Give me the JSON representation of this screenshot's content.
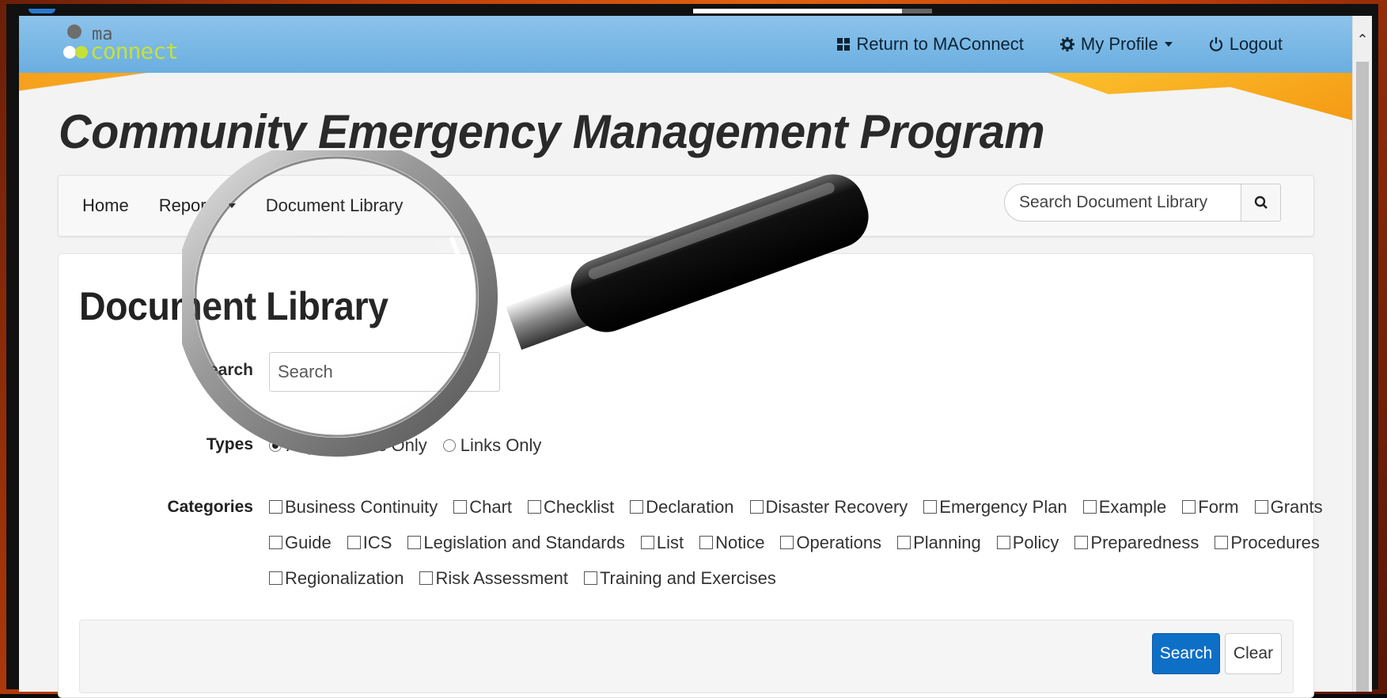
{
  "brand": {
    "logo_text_top": "ma",
    "logo_text_bottom": "connect",
    "colors": {
      "topbar": "#7bb9e6",
      "accent_orange": "#f6a11d",
      "logo_green": "#c6e03a",
      "primary_button": "#0e6fc7"
    }
  },
  "topnav": {
    "return_label": "Return to MAConnect",
    "return_icon": "grid-icon",
    "profile_label": "My Profile",
    "profile_icon": "gear-icon",
    "logout_label": "Logout",
    "logout_icon": "power-icon"
  },
  "program_title": "Community Emergency Management Program",
  "subnav": {
    "items": [
      {
        "label": "Home"
      },
      {
        "label": "Reports"
      },
      {
        "label": "Document Library"
      }
    ],
    "search_placeholder": "Search Document Library",
    "search_icon": "search-icon"
  },
  "library": {
    "title": "Document Library",
    "search_label": "Search",
    "search_placeholder": "Search",
    "types_label": "Types",
    "types": [
      {
        "label": "Any",
        "checked": true
      },
      {
        "label": "Files Only",
        "checked": false
      },
      {
        "label": "Links Only",
        "checked": false
      }
    ],
    "categories_label": "Categories",
    "categories": [
      [
        "Business Continuity",
        "Chart",
        "Checklist",
        "Declaration",
        "Disaster Recovery",
        "Emergency Plan",
        "Example",
        "Form",
        "Grants"
      ],
      [
        "Guide",
        "ICS",
        "Legislation and Standards",
        "List",
        "Notice",
        "Operations",
        "Planning",
        "Policy",
        "Preparedness",
        "Procedures"
      ],
      [
        "Regionalization",
        "Risk Assessment",
        "Training and Exercises"
      ]
    ],
    "search_button": "Search",
    "clear_button": "Clear"
  }
}
